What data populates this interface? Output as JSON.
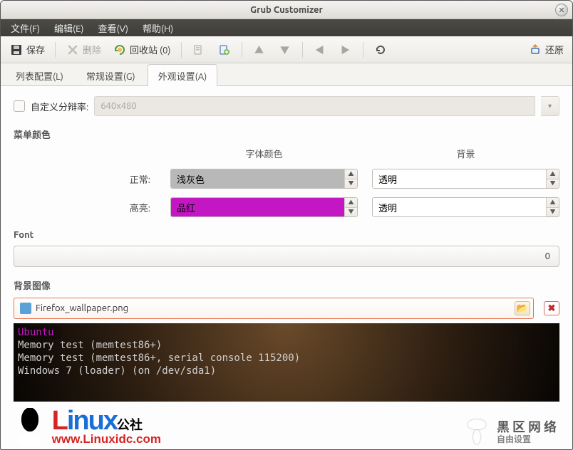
{
  "title": "Grub Customizer",
  "menubar": [
    "文件(F)",
    "编辑(E)",
    "查看(V)",
    "帮助(H)"
  ],
  "toolbar": {
    "save": "保存",
    "delete": "删除",
    "recyclebin": "回收站 (0)",
    "restore": "还原"
  },
  "tabs": [
    "列表配置(L)",
    "常规设置(G)",
    "外观设置(A)"
  ],
  "resolution": {
    "checkbox_label": "自定义分辩率:",
    "value": "640x480"
  },
  "menu_colors": {
    "section": "菜单颜色",
    "col_font": "字体颜色",
    "col_bg": "背景",
    "row_normal": "正常:",
    "row_highlight": "高亮:",
    "normal_font": {
      "label": "浅灰色",
      "bg": "#b8b8b8",
      "fg": "#000"
    },
    "normal_bg": {
      "label": "透明",
      "bg": "#ffffff",
      "fg": "#000"
    },
    "hl_font": {
      "label": "品红",
      "bg": "#c317c3",
      "fg": "#000"
    },
    "hl_bg": {
      "label": "透明",
      "bg": "#ffffff",
      "fg": "#000"
    }
  },
  "font": {
    "section": "Font",
    "size": "0"
  },
  "bg_image": {
    "section": "背景图像",
    "filename": "Firefox_wallpaper.png"
  },
  "preview_lines": {
    "highlight": "Ubuntu",
    "l2": "Memory test (memtest86+)",
    "l3": "Memory test (memtest86+, serial console 115200)",
    "l4": "Windows 7 (loader) (on /dev/sda1)"
  },
  "watermark1": {
    "linux_word": {
      "L": "L",
      "i": "i",
      "rest": "nux",
      "cn": "公社"
    },
    "url": "www.Linuxidc.com"
  },
  "watermark2": {
    "line1": "黑区网络",
    "line2": "自由设置"
  }
}
